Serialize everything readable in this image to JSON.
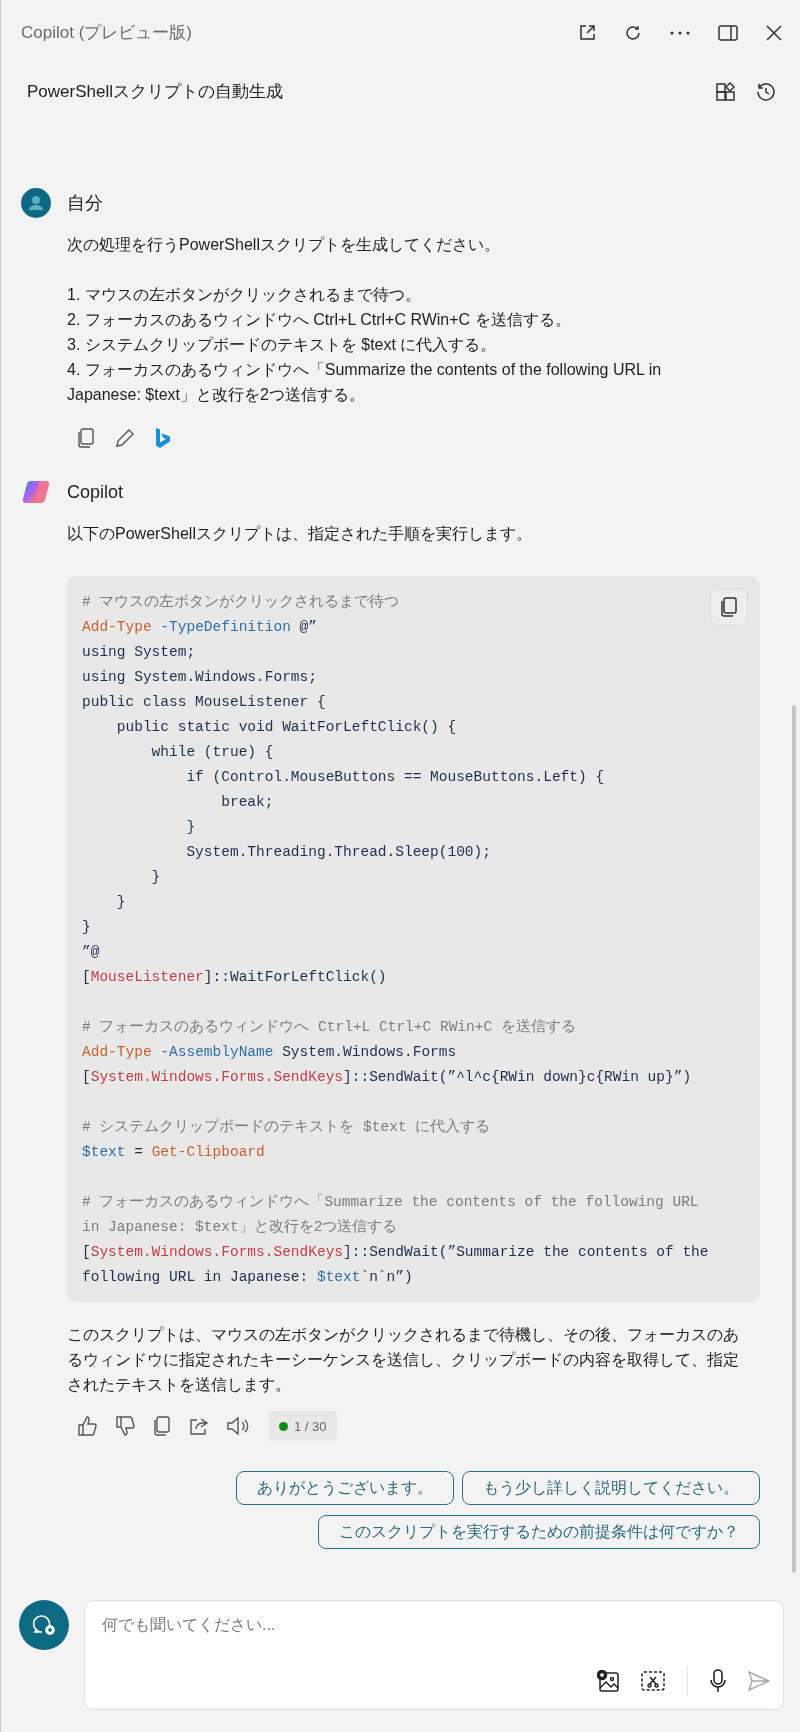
{
  "window": {
    "title": "Copilot (プレビュー版)"
  },
  "conversation": {
    "title": "PowerShellスクリプトの自動生成"
  },
  "user_message": {
    "author": "自分",
    "intro": "次の処理を行うPowerShellスクリプトを生成してください。",
    "items": [
      "1. マウスの左ボタンがクリックされるまで待つ。",
      "2. フォーカスのあるウィンドウへ Ctrl+L Ctrl+C RWin+C を送信する。",
      "3. システムクリップボードのテキストを $text に代入する。",
      "4. フォーカスのあるウィンドウへ「Summarize the contents of the following URL in Japanese: $text」と改行を2つ送信する。"
    ]
  },
  "reply": {
    "author": "Copilot",
    "intro": "以下のPowerShellスクリプトは、指定された手順を実行します。",
    "code_blocks": [
      [
        [
          {
            "kind": "comment",
            "text": "# マウスの左ボタンがクリックされるまで待つ"
          }
        ],
        [
          {
            "kind": "cmdlet",
            "text": "Add-Type"
          },
          {
            "kind": "parameter",
            "text": " -TypeDefinition"
          },
          {
            "kind": "plain",
            "text": " @”"
          }
        ],
        [
          {
            "kind": "plain",
            "text": "using System;"
          }
        ],
        [
          {
            "kind": "plain",
            "text": "using System.Windows.Forms;"
          }
        ],
        [
          {
            "kind": "plain",
            "text": "public class MouseListener {"
          }
        ],
        [
          {
            "kind": "plain",
            "text": "    public static void WaitForLeftClick() {"
          }
        ],
        [
          {
            "kind": "plain",
            "text": "        while (true) {"
          }
        ],
        [
          {
            "kind": "plain",
            "text": "            if (Control.MouseButtons == MouseButtons.Left) {"
          }
        ],
        [
          {
            "kind": "plain",
            "text": "                break;"
          }
        ],
        [
          {
            "kind": "plain",
            "text": "            }"
          }
        ],
        [
          {
            "kind": "plain",
            "text": "            System.Threading.Thread.Sleep(100);"
          }
        ],
        [
          {
            "kind": "plain",
            "text": "        }"
          }
        ],
        [
          {
            "kind": "plain",
            "text": "    }"
          }
        ],
        [
          {
            "kind": "plain",
            "text": "}"
          }
        ],
        [
          {
            "kind": "plain",
            "text": "”@"
          }
        ],
        [
          {
            "kind": "plain",
            "text": "["
          },
          {
            "kind": "type",
            "text": "MouseListener"
          },
          {
            "kind": "plain",
            "text": "]::WaitForLeftClick()"
          }
        ]
      ],
      [
        [
          {
            "kind": "comment",
            "text": "# フォーカスのあるウィンドウへ Ctrl+L Ctrl+C RWin+C を送信する"
          }
        ],
        [
          {
            "kind": "cmdlet",
            "text": "Add-Type"
          },
          {
            "kind": "parameter",
            "text": " -AssemblyName"
          },
          {
            "kind": "plain",
            "text": " System.Windows.Forms"
          }
        ],
        [
          {
            "kind": "plain",
            "text": "["
          },
          {
            "kind": "type",
            "text": "System.Windows.Forms.SendKeys"
          },
          {
            "kind": "plain",
            "text": "]::SendWait(”^l^c{RWin down}c{RWin up}”)"
          }
        ]
      ],
      [
        [
          {
            "kind": "comment",
            "text": "# システムクリップボードのテキストを $text に代入する"
          }
        ],
        [
          {
            "kind": "variable",
            "text": "$text"
          },
          {
            "kind": "plain",
            "text": " = "
          },
          {
            "kind": "cmdlet",
            "text": "Get-Clipboard"
          }
        ]
      ],
      [
        [
          {
            "kind": "comment",
            "text": "# フォーカスのあるウィンドウへ「Summarize the contents of the following URL"
          }
        ],
        [
          {
            "kind": "comment",
            "text": "in Japanese: $text」と改行を2つ送信する"
          }
        ],
        [
          {
            "kind": "plain",
            "text": "["
          },
          {
            "kind": "type",
            "text": "System.Windows.Forms.SendKeys"
          },
          {
            "kind": "plain",
            "text": "]::SendWait(”Summarize the contents of the"
          }
        ],
        [
          {
            "kind": "plain",
            "text": "following URL in Japanese: "
          },
          {
            "kind": "variable",
            "text": "$text"
          },
          {
            "kind": "plain",
            "text": "`n`n”)"
          }
        ]
      ]
    ],
    "summary": "このスクリプトは、マウスの左ボタンがクリックされるまで待機し、その後、フォーカスのあるウィンドウに指定されたキーシーケンスを送信し、クリップボードの内容を取得して、指定されたテキストを送信します。",
    "turn_counter": "1 / 30"
  },
  "suggestions": [
    "ありがとうございます。",
    "もう少し詳しく説明してください。",
    "このスクリプトを実行するための前提条件は何ですか？"
  ],
  "input": {
    "placeholder": "何でも聞いてください..."
  }
}
